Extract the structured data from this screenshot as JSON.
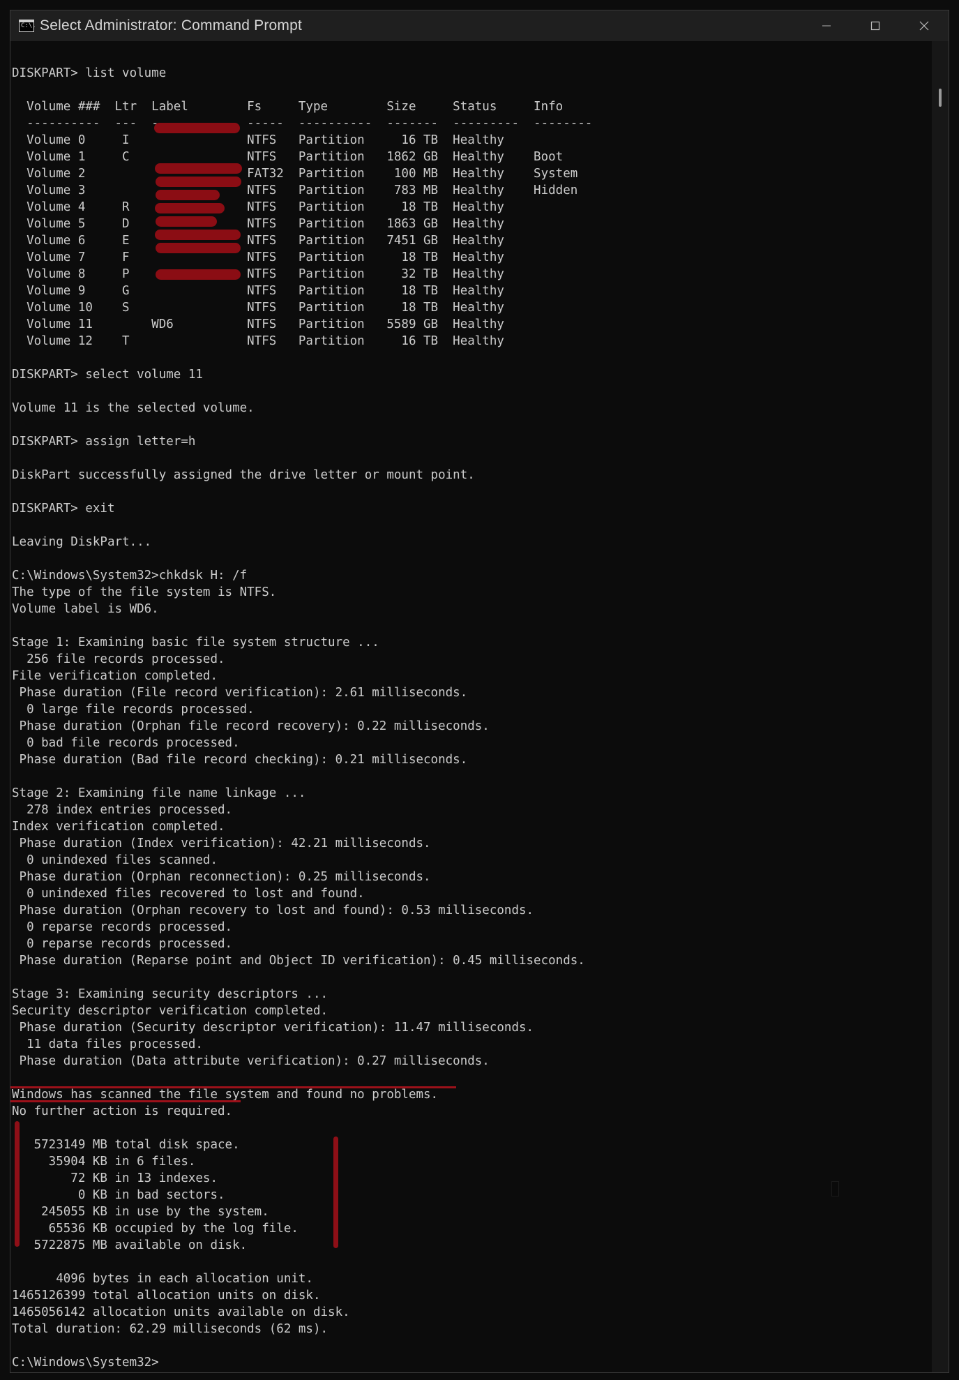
{
  "window": {
    "title": "Select Administrator: Command Prompt",
    "icon_text": "C:\\."
  },
  "console": {
    "lines": [
      "DISKPART> list volume",
      "",
      "  Volume ###  Ltr  Label        Fs     Type        Size     Status     Info",
      "  ----------  ---  -----------  -----  ----------  -------  ---------  --------",
      "  Volume 0     I                NTFS   Partition     16 TB  Healthy",
      "  Volume 1     C                NTFS   Partition   1862 GB  Healthy    Boot",
      "  Volume 2                      FAT32  Partition    100 MB  Healthy    System",
      "  Volume 3                      NTFS   Partition    783 MB  Healthy    Hidden",
      "  Volume 4     R                NTFS   Partition     18 TB  Healthy",
      "  Volume 5     D                NTFS   Partition   1863 GB  Healthy",
      "  Volume 6     E                NTFS   Partition   7451 GB  Healthy",
      "  Volume 7     F                NTFS   Partition     18 TB  Healthy",
      "  Volume 8     P                NTFS   Partition     32 TB  Healthy",
      "  Volume 9     G                NTFS   Partition     18 TB  Healthy",
      "  Volume 10    S                NTFS   Partition     18 TB  Healthy",
      "  Volume 11        WD6          NTFS   Partition   5589 GB  Healthy",
      "  Volume 12    T                NTFS   Partition     16 TB  Healthy",
      "",
      "DISKPART> select volume 11",
      "",
      "Volume 11 is the selected volume.",
      "",
      "DISKPART> assign letter=h",
      "",
      "DiskPart successfully assigned the drive letter or mount point.",
      "",
      "DISKPART> exit",
      "",
      "Leaving DiskPart...",
      "",
      "C:\\Windows\\System32>chkdsk H: /f",
      "The type of the file system is NTFS.",
      "Volume label is WD6.",
      "",
      "Stage 1: Examining basic file system structure ...",
      "  256 file records processed.",
      "File verification completed.",
      " Phase duration (File record verification): 2.61 milliseconds.",
      "  0 large file records processed.",
      " Phase duration (Orphan file record recovery): 0.22 milliseconds.",
      "  0 bad file records processed.",
      " Phase duration (Bad file record checking): 0.21 milliseconds.",
      "",
      "Stage 2: Examining file name linkage ...",
      "  278 index entries processed.",
      "Index verification completed.",
      " Phase duration (Index verification): 42.21 milliseconds.",
      "  0 unindexed files scanned.",
      " Phase duration (Orphan reconnection): 0.25 milliseconds.",
      "  0 unindexed files recovered to lost and found.",
      " Phase duration (Orphan recovery to lost and found): 0.53 milliseconds.",
      "  0 reparse records processed.",
      "  0 reparse records processed.",
      " Phase duration (Reparse point and Object ID verification): 0.45 milliseconds.",
      "",
      "Stage 3: Examining security descriptors ...",
      "Security descriptor verification completed.",
      " Phase duration (Security descriptor verification): 11.47 milliseconds.",
      "  11 data files processed.",
      " Phase duration (Data attribute verification): 0.27 milliseconds.",
      "",
      "Windows has scanned the file system and found no problems.",
      "No further action is required.",
      "",
      "   5723149 MB total disk space.",
      "     35904 KB in 6 files.",
      "        72 KB in 13 indexes.",
      "         0 KB in bad sectors.",
      "    245055 KB in use by the system.",
      "     65536 KB occupied by the log file.",
      "   5722875 MB available on disk.",
      "",
      "      4096 bytes in each allocation unit.",
      "1465126399 total allocation units on disk.",
      "1465056142 allocation units available on disk.",
      "Total duration: 62.29 milliseconds (62 ms).",
      "",
      "C:\\Windows\\System32>"
    ]
  },
  "colors": {
    "background": "#0c0c0c",
    "text": "#cccccc",
    "annotation_red": "#8b0d14"
  }
}
